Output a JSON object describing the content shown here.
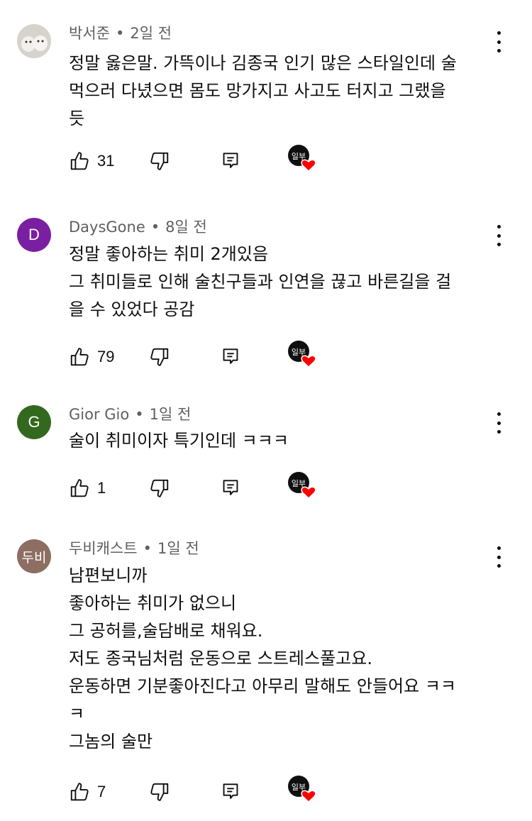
{
  "comments": [
    {
      "author": "박서준",
      "time": "2일 전",
      "avatar_letter": "",
      "avatar_color": "#dcdad5",
      "text": "정말 옳은말. 가뜩이나 김종국 인기 많은 스타일인데 술\n먹으러 다녔으면 몸도 망가지고 사고도 터지고 그랬을\n듯",
      "likes": "31",
      "creator_badge": "일부"
    },
    {
      "author": "DaysGone",
      "time": "8일 전",
      "avatar_letter": "D",
      "avatar_color": "#7b1fa2",
      "text": "정말 좋아하는 취미 2개있음\n그 취미들로 인해 술친구들과 인연을 끊고 바른길을 걸\n을 수 있었다 공감",
      "likes": "79",
      "creator_badge": "일부"
    },
    {
      "author": "Gior Gio",
      "time": "1일 전",
      "avatar_letter": "G",
      "avatar_color": "#33691e",
      "text": "술이 취미이자 특기인데 ㅋㅋㅋ",
      "likes": "1",
      "creator_badge": "일부"
    },
    {
      "author": "두비캐스트",
      "time": "1일 전",
      "avatar_letter": "두비",
      "avatar_color": "#8d6e63",
      "text": "남편보니까\n좋아하는 취미가 없으니\n그 공허를,술담배로 채워요.\n저도 종국님처럼 운동으로 스트레스풀고요.\n운동하면 기분좋아진다고 아무리 말해도 안들어요 ㅋㅋ\nㅋ\n그놈의 술만",
      "likes": "7",
      "creator_badge": "일부"
    }
  ],
  "separator": "•",
  "icons": {
    "like": "thumbs-up-icon",
    "dislike": "thumbs-down-icon",
    "reply": "reply-icon",
    "more": "more-vert-icon",
    "heart": "heart-icon"
  },
  "colors": {
    "heart": "#ff0000",
    "meta": "#606060",
    "text": "#0f0f0f"
  }
}
